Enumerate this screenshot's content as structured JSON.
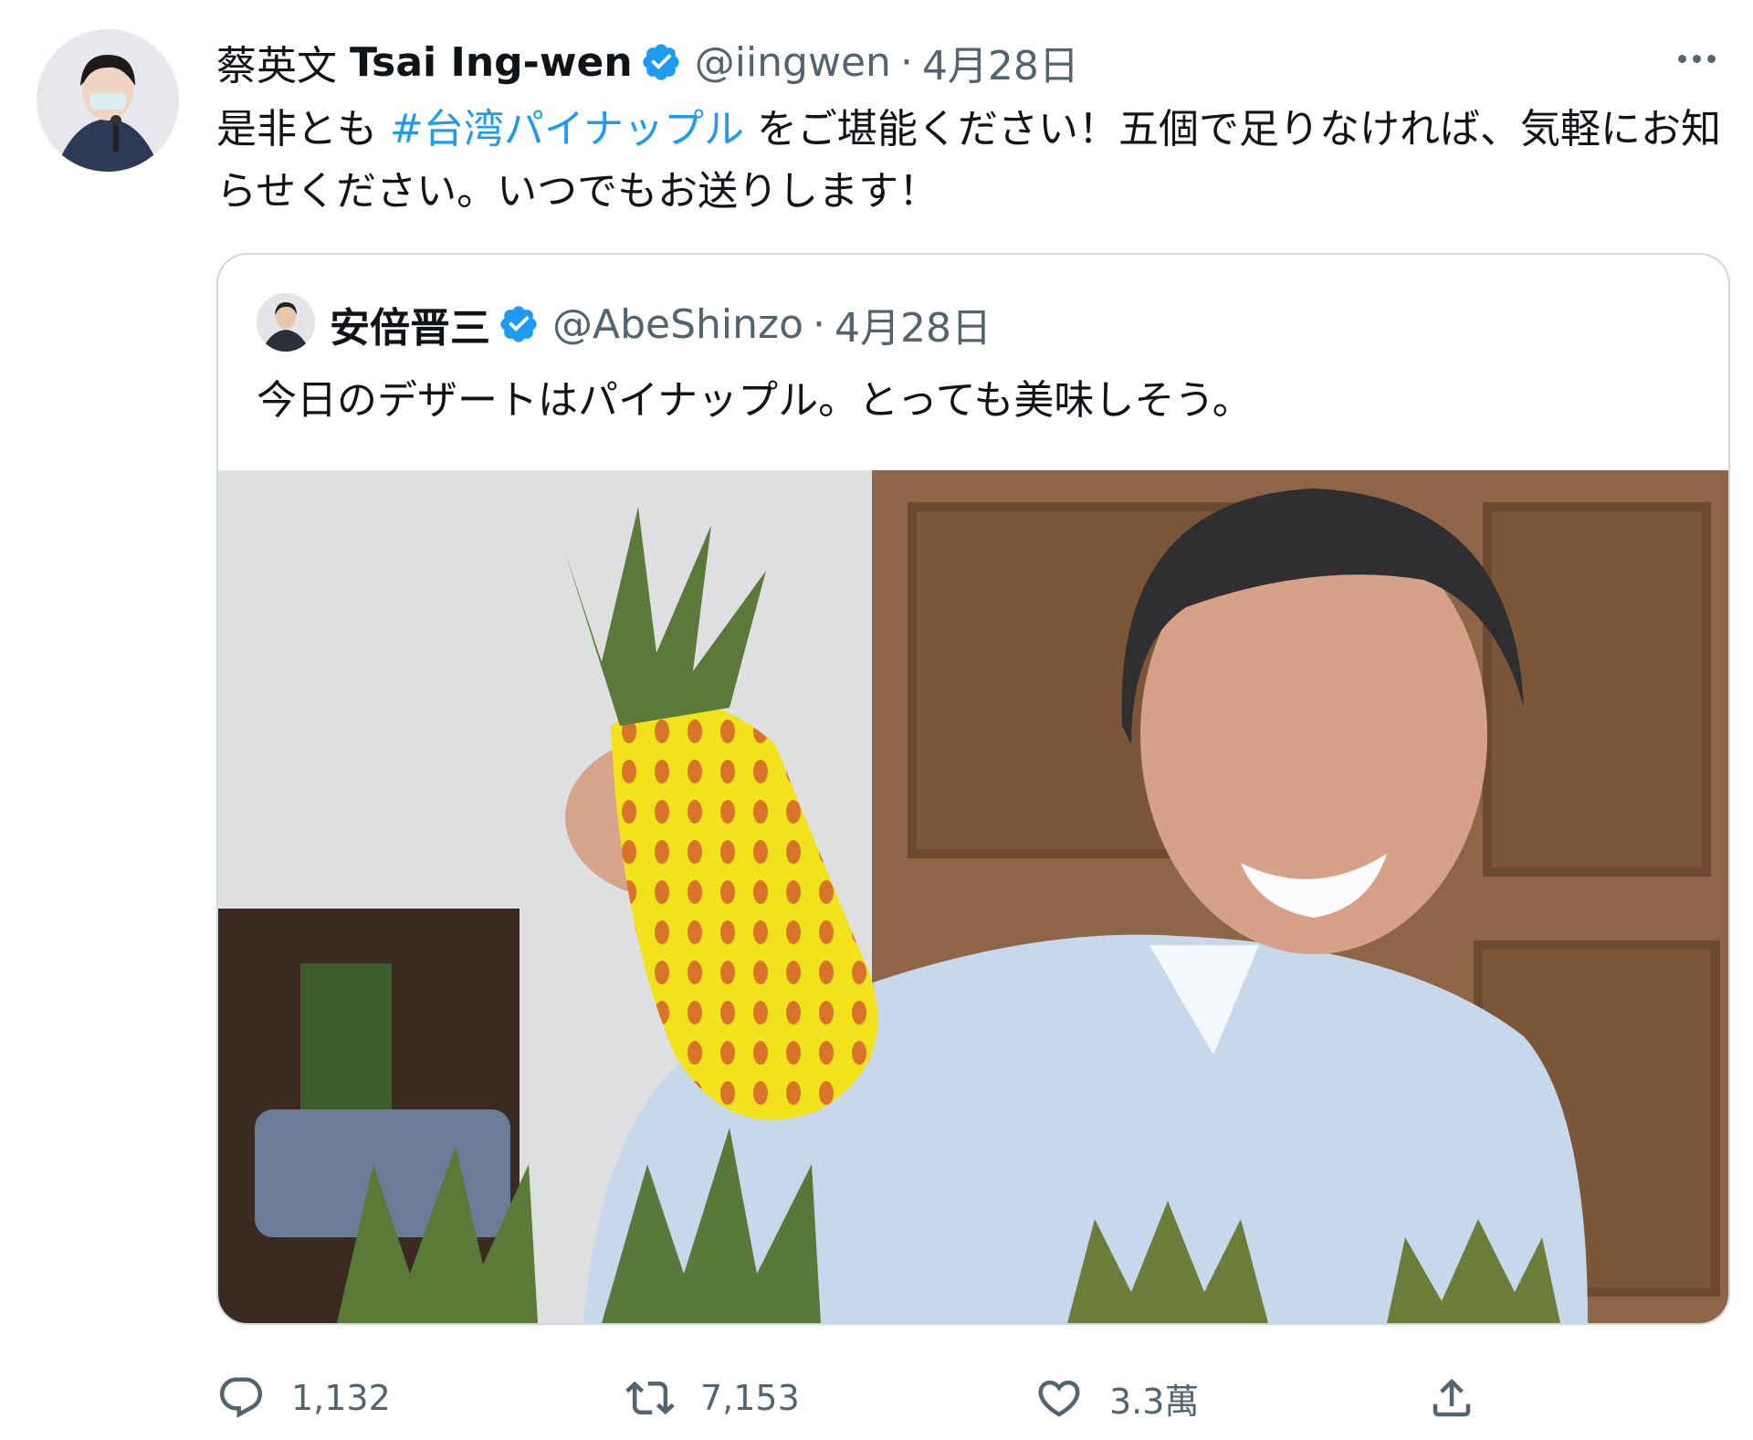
{
  "tweet": {
    "author_name_jp": "蔡英文",
    "author_name_en": "Tsai Ing-wen",
    "handle": "@iingwen",
    "separator": "·",
    "date": "4月28日",
    "text_before": "是非とも ",
    "hashtag": "#台湾パイナップル",
    "text_after": " をご堪能ください！五個で足りなければ、気軽にお知らせください。いつでもお送りします！"
  },
  "quoted_tweet": {
    "author_name": "安倍晋三",
    "handle": "@AbeShinzo",
    "separator": "·",
    "date": "4月28日",
    "text": "今日のデザートはパイナップル。とっても美味しそう。"
  },
  "actions": {
    "reply_count": "1,132",
    "retweet_count": "7,153",
    "like_count": "3.3萬"
  },
  "colors": {
    "accent": "#1d9bf0",
    "secondary_text": "#536471",
    "border": "#cfd9de"
  },
  "icons": [
    "more-icon",
    "verified-badge-icon",
    "reply-icon",
    "retweet-icon",
    "like-icon",
    "share-icon"
  ]
}
